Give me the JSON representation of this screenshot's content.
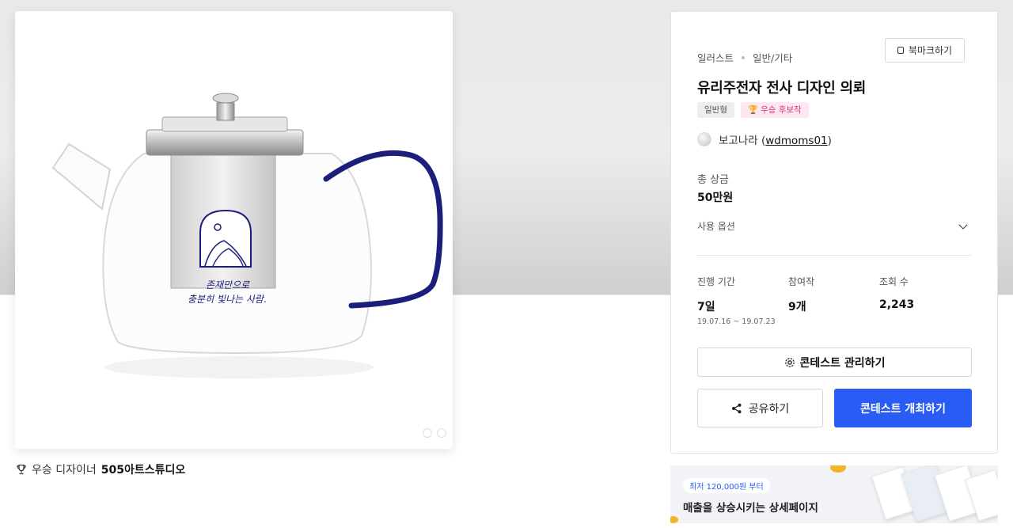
{
  "product_image": {
    "label_line1": "존재만으로",
    "label_line2": "충분히 빛나는 사람."
  },
  "winner": {
    "prefix": "우승 디자이너",
    "name": "505아트스튜디오"
  },
  "panel": {
    "category": "일러스트",
    "subcategory": "일반/기타",
    "bookmark_label": "북마크하기",
    "title": "유리주전자 전사 디자인 의뢰",
    "badge_type": "일반형",
    "badge_award": "우승 후보작",
    "host_name": "보고나라",
    "host_handle": "wdmoms01",
    "prize_label": "총 상금",
    "prize_value": "50만원",
    "usage_label": "사용 옵션",
    "stats": [
      {
        "key": "진행 기간",
        "value": "7일",
        "sub": "19.07.16 ~ 19.07.23"
      },
      {
        "key": "참여작",
        "value": "9개",
        "sub": ""
      },
      {
        "key": "조회 수",
        "value": "2,243",
        "sub": ""
      }
    ],
    "manage_label": "콘테스트 관리하기",
    "share_label": "공유하기",
    "host_contest_label": "콘테스트 개최하기"
  },
  "ad": {
    "pill": "최저 120,000원 부터",
    "headline": "매출을 상승시키는 상세페이지"
  },
  "colors": {
    "accent_blue": "#2a5cf5",
    "award_pink": "#d63384",
    "handle_navy": "#1c1f7a"
  }
}
